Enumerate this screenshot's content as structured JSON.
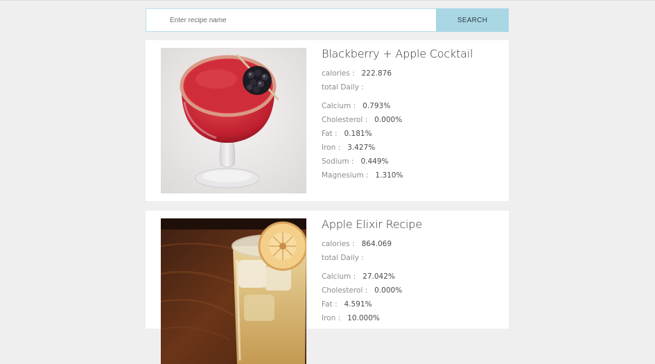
{
  "search": {
    "placeholder": "Enter recipe name",
    "button_label": "SEARCH"
  },
  "recipes": [
    {
      "title": "Blackberry + Apple Cocktail",
      "calories_label": "calories :",
      "calories": "222.876",
      "total_daily_label": "total Daily :",
      "nutrients": [
        {
          "label": "Calcium :",
          "value": "0.793%"
        },
        {
          "label": "Cholesterol :",
          "value": "0.000%"
        },
        {
          "label": "Fat :",
          "value": "0.181%"
        },
        {
          "label": "Iron :",
          "value": "3.427%"
        },
        {
          "label": "Sodium :",
          "value": "0.449%"
        },
        {
          "label": "Magnesium :",
          "value": "1.310%"
        }
      ]
    },
    {
      "title": "Apple Elixir Recipe",
      "calories_label": "calories :",
      "calories": "864.069",
      "total_daily_label": "total Daily :",
      "nutrients": [
        {
          "label": "Calcium :",
          "value": "27.042%"
        },
        {
          "label": "Cholesterol :",
          "value": "0.000%"
        },
        {
          "label": "Fat :",
          "value": "4.591%"
        },
        {
          "label": "Iron :",
          "value": "10.000%"
        }
      ]
    }
  ]
}
